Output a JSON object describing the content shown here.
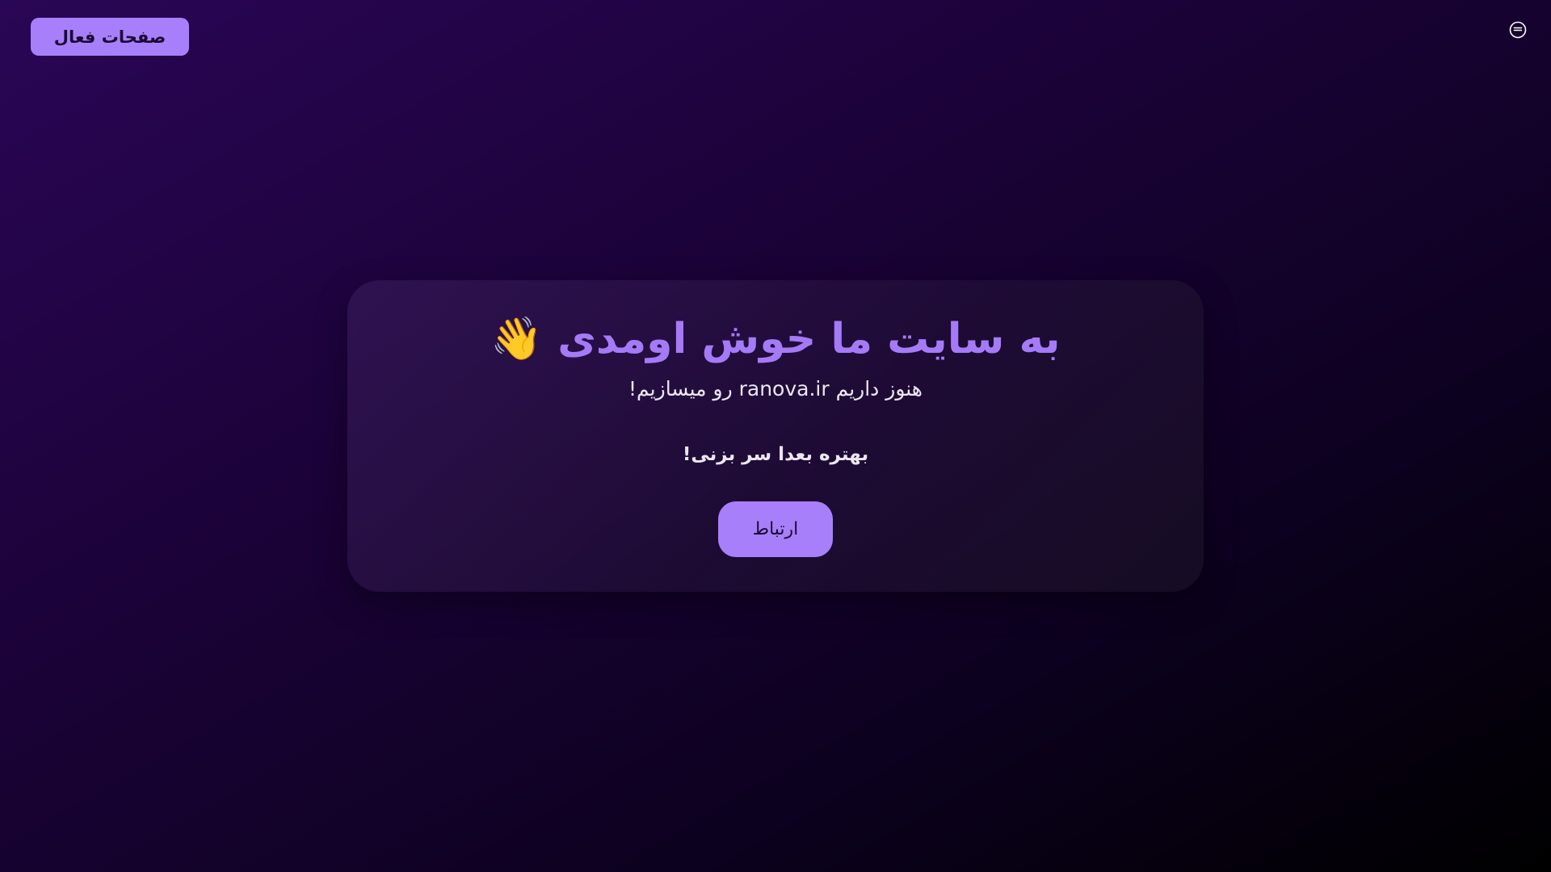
{
  "header": {
    "active_pages_label": "صفحات فعال",
    "menu_icon": "menu-circle-icon"
  },
  "card": {
    "title": "به سایت ما خوش اومدی 👋",
    "subtitle": "هنوز داریم ranova.ir رو میسازیم!",
    "later_text": "بهتره بعدا سر بزنی!",
    "contact_label": "ارتباط"
  },
  "colors": {
    "accent": "#a87ffb",
    "title": "#a57af7",
    "background_start": "#2a0656",
    "background_end": "#000000"
  }
}
